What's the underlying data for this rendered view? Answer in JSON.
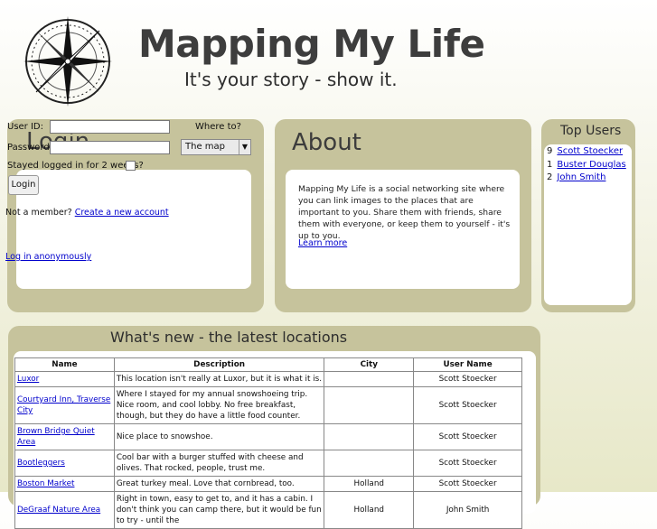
{
  "header": {
    "title": "Mapping My Life",
    "tagline": "It's your story - show it."
  },
  "login": {
    "heading": "Login",
    "user_id_label": "User ID:",
    "password_label": "Password:",
    "where_to_label": "Where to?",
    "where_to_selected": "The map",
    "stay_logged_label": "Stayed logged in for 2 weeks?",
    "login_button": "Login",
    "not_member_text": "Not a member?",
    "create_account_link": "Create a new account",
    "anonymous_link": "Log in anonymously"
  },
  "about": {
    "heading": "About",
    "text": "Mapping My Life is a social networking site where you can link images to the places that are important to you. Share them with friends, share them with everyone, or keep them to yourself - it's up to you.",
    "learn_more": "Learn more"
  },
  "top_users": {
    "heading": "Top Users",
    "items": [
      {
        "count": "9",
        "name": "Scott Stoecker"
      },
      {
        "count": "1",
        "name": "Buster Douglas"
      },
      {
        "count": "2",
        "name": "John Smith"
      }
    ]
  },
  "latest": {
    "heading": "What's new - the latest locations",
    "columns": [
      "Name",
      "Description",
      "City",
      "User Name"
    ],
    "rows": [
      {
        "name": "Luxor",
        "description": "This location isn't really at Luxor, but it is what it is.",
        "city": "",
        "user": "Scott Stoecker"
      },
      {
        "name": "Courtyard Inn, Traverse City",
        "description": "Where I stayed for my annual snowshoeing trip. Nice room, and cool lobby. No free breakfast, though, but they do have a little food counter.",
        "city": "",
        "user": "Scott Stoecker"
      },
      {
        "name": "Brown Bridge Quiet Area",
        "description": "Nice place to snowshoe.",
        "city": "",
        "user": "Scott Stoecker"
      },
      {
        "name": "Bootleggers",
        "description": "Cool bar with a burger stuffed with cheese and olives. That rocked, people, trust me.",
        "city": "",
        "user": "Scott Stoecker"
      },
      {
        "name": "Boston Market",
        "description": "Great turkey meal. Love that cornbread, too.",
        "city": "Holland",
        "user": "Scott Stoecker"
      },
      {
        "name": "DeGraaf Nature Area",
        "description": "Right in town, easy to get to, and it has a cabin. I don't think you can camp there, but it would be fun to try - until the",
        "city": "Holland",
        "user": "John Smith"
      }
    ]
  }
}
